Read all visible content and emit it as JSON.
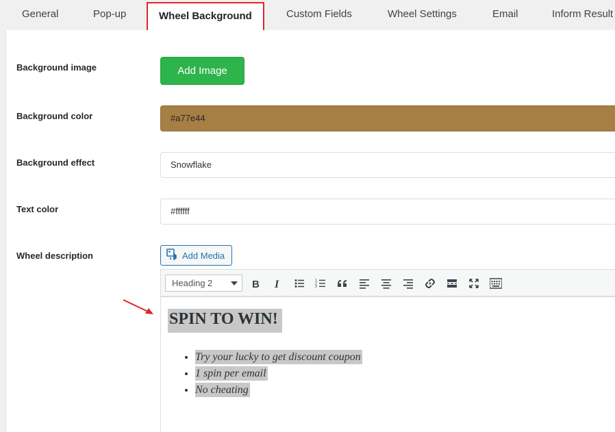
{
  "tabs": [
    {
      "label": "General"
    },
    {
      "label": "Pop-up"
    },
    {
      "label": "Wheel Background"
    },
    {
      "label": "Custom Fields"
    },
    {
      "label": "Wheel Settings"
    },
    {
      "label": "Email"
    },
    {
      "label": "Inform Result"
    }
  ],
  "active_tab": "Wheel Background",
  "form": {
    "background_image": {
      "label": "Background image",
      "button_label": "Add Image"
    },
    "background_color": {
      "label": "Background color",
      "value": "#a77e44"
    },
    "background_effect": {
      "label": "Background effect",
      "value": "Snowflake"
    },
    "text_color": {
      "label": "Text color",
      "value": "#ffffff"
    },
    "wheel_description": {
      "label": "Wheel description",
      "add_media_label": "Add Media"
    }
  },
  "editor": {
    "format_select": "Heading 2",
    "toolbar_icons": [
      "bold-icon",
      "italic-icon",
      "bullet-list-icon",
      "numbered-list-icon",
      "blockquote-icon",
      "align-left-icon",
      "align-center-icon",
      "align-right-icon",
      "link-icon",
      "read-more-icon",
      "fullscreen-icon",
      "toolbar-toggle-icon"
    ],
    "content": {
      "heading": "SPIN TO WIN!",
      "items": [
        "Try your lucky to get discount coupon",
        "1 spin per email",
        "No cheating"
      ]
    }
  },
  "colors": {
    "accent_green": "#2db44b",
    "highlight_red": "#e02424",
    "link_blue": "#2271b1",
    "background_color_swatch": "#a77e44"
  }
}
